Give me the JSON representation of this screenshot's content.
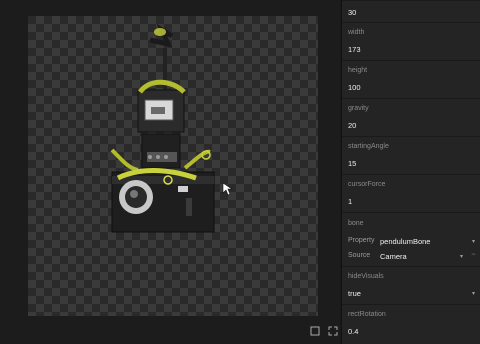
{
  "properties": [
    {
      "label": "",
      "value": "30"
    },
    {
      "label": "width",
      "value": "173"
    },
    {
      "label": "height",
      "value": "100"
    },
    {
      "label": "gravity",
      "value": "20"
    },
    {
      "label": "startingAngle",
      "value": "15"
    },
    {
      "label": "cursorForce",
      "value": "1"
    },
    {
      "label": "bone",
      "property_label": "Property",
      "property_value": "pendulumBone",
      "source_label": "Source",
      "source_value": "Camera"
    },
    {
      "label": "hideVisuals",
      "value": "true"
    },
    {
      "label": "rectRotation",
      "value": "0.4"
    }
  ],
  "icons": {
    "frame": "frame-icon",
    "expand": "expand-icon",
    "cursor": "cursor-pointer-icon"
  },
  "colors": {
    "moss": "#c9d23a",
    "panel_bg": "#242424",
    "canvas_bg": "#1c1c1c"
  }
}
